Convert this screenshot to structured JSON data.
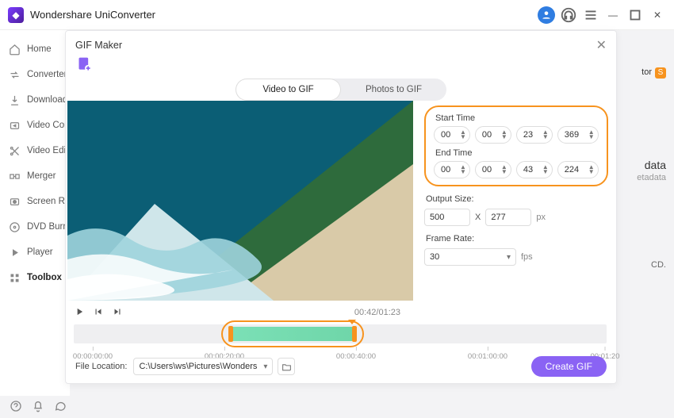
{
  "app": {
    "title": "Wondershare UniConverter"
  },
  "sidebar": {
    "items": [
      {
        "label": "Home"
      },
      {
        "label": "Converter"
      },
      {
        "label": "Downloader"
      },
      {
        "label": "Video Compressor"
      },
      {
        "label": "Video Editor"
      },
      {
        "label": "Merger"
      },
      {
        "label": "Screen Recorder"
      },
      {
        "label": "DVD Burner"
      },
      {
        "label": "Player"
      },
      {
        "label": "Toolbox"
      }
    ]
  },
  "bg": {
    "tor": "tor",
    "data": "data",
    "etadata": "etadata",
    "cd": "CD."
  },
  "modal": {
    "title": "GIF Maker",
    "tabs": {
      "video": "Video to GIF",
      "photos": "Photos to GIF"
    },
    "start_label": "Start Time",
    "end_label": "End Time",
    "start": {
      "h": "00",
      "m": "00",
      "s": "23",
      "ms": "369"
    },
    "end": {
      "h": "00",
      "m": "00",
      "s": "43",
      "ms": "224"
    },
    "output_size_label": "Output Size:",
    "output_w": "500",
    "output_h": "277",
    "px": "px",
    "x": "X",
    "frame_rate_label": "Frame Rate:",
    "frame_rate": "30",
    "fps": "fps",
    "play_time": "00:42/01:23",
    "file_location_label": "File Location:",
    "file_location": "C:\\Users\\ws\\Pictures\\Wonders",
    "create": "Create GIF",
    "ticks": [
      "00:00:00:00",
      "00:00:20:00",
      "00:00:40:00",
      "00:01:00:00",
      "00:01:20"
    ]
  }
}
